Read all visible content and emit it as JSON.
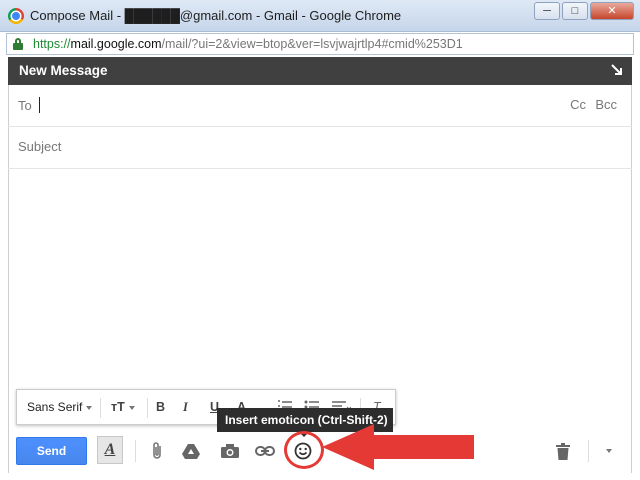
{
  "window": {
    "title": "Compose Mail - ██████@gmail.com - Gmail - Google Chrome",
    "buttons": {
      "minimize": "─",
      "maximize": "□",
      "close": "✕"
    }
  },
  "addressbar": {
    "url_scheme": "https://",
    "url_host": "mail.google.com",
    "url_rest": "/mail/?ui=2&view=btop&ver=lsvjwajrtlp4#cmid%253D1"
  },
  "compose": {
    "title": "New Message",
    "to_label": "To",
    "cc_label": "Cc",
    "bcc_label": "Bcc",
    "subject_placeholder": "Subject"
  },
  "format_bar": {
    "font": "Sans Serif",
    "size_icon": "тТ",
    "bold": "B",
    "italic": "I",
    "underline": "U",
    "text_color": "A",
    "remove_format": "T"
  },
  "tooltip": {
    "text": "Insert emoticon (Ctrl-Shift-2)"
  },
  "toolbar": {
    "send_label": "Send",
    "format_toggle": "A"
  },
  "colors": {
    "header_bg": "#404040",
    "send_bg": "#4d90fe",
    "annotation_red": "#e53935"
  },
  "icons": [
    "lock-icon",
    "expand-icon",
    "attach-icon",
    "drive-icon",
    "camera-icon",
    "link-icon",
    "emoticon-icon",
    "trash-icon",
    "more-options-icon"
  ]
}
